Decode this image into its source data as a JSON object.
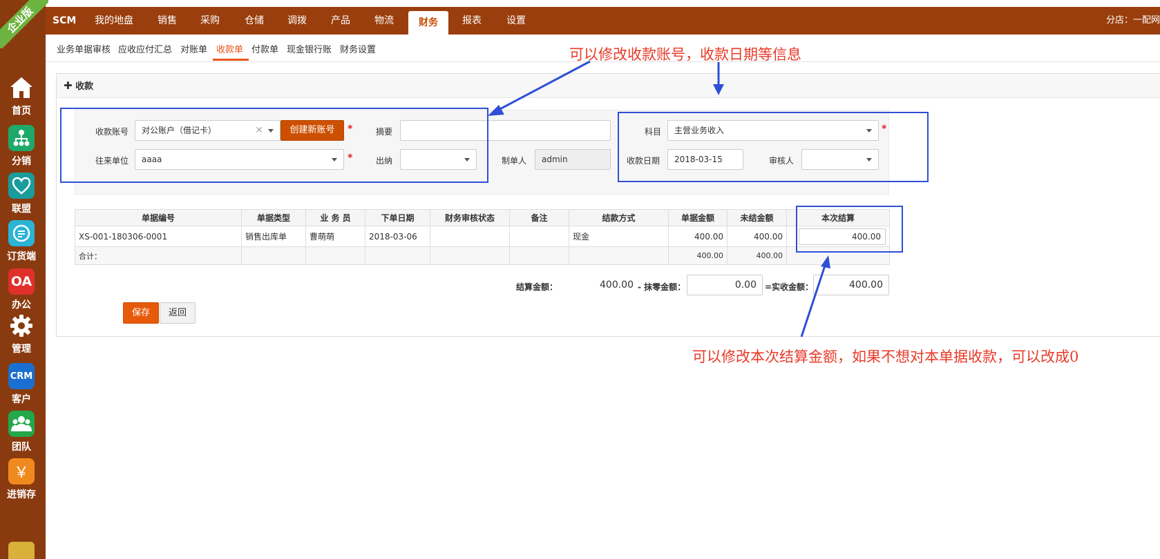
{
  "sidebar": {
    "ribbon": "企业版",
    "items": [
      {
        "label": "首页",
        "icon": "home-icon"
      },
      {
        "label": "分销",
        "icon": "distribution-icon"
      },
      {
        "label": "联盟",
        "icon": "alliance-icon"
      },
      {
        "label": "订货端",
        "icon": "order-client-icon"
      },
      {
        "label": "办公",
        "icon": "oa-icon",
        "text": "OA"
      },
      {
        "label": "管理",
        "icon": "gear-icon"
      },
      {
        "label": "客户",
        "icon": "crm-icon",
        "text": "CRM"
      },
      {
        "label": "团队",
        "icon": "team-icon"
      },
      {
        "label": "进销存",
        "icon": "yen-icon",
        "text": "￥"
      }
    ]
  },
  "topnav": {
    "brand": "SCM",
    "items": [
      "我的地盘",
      "销售",
      "采购",
      "仓储",
      "调拨",
      "产品",
      "物流",
      "财务",
      "报表",
      "设置"
    ],
    "active": "财务",
    "branch": "分店：一配网"
  },
  "subtabs": {
    "items": [
      "业务单据审核",
      "应收应付汇总",
      "对账单",
      "收款单",
      "付款单",
      "现金银行账",
      "财务设置"
    ],
    "active": "收款单"
  },
  "panel": {
    "title": "收款"
  },
  "form": {
    "account_label": "收款账号",
    "account_value": "对公账户（借记卡）",
    "create_account_label": "创建新账号",
    "summary_label": "摘要",
    "summary_value": "",
    "subject_label": "科目",
    "subject_value": "主营业务收入",
    "partner_label": "往来单位",
    "partner_value": "aaaa",
    "cashier_label": "出纳",
    "cashier_value": "",
    "maker_label": "制单人",
    "maker_value": "admin",
    "date_label": "收款日期",
    "date_value": "2018-03-15",
    "reviewer_label": "审核人",
    "reviewer_value": "",
    "required_mark": "*"
  },
  "table": {
    "headers": [
      "单据编号",
      "单据类型",
      "业 务 员",
      "下单日期",
      "财务审核状态",
      "备注",
      "结款方式",
      "单据金额",
      "未结金额",
      "本次结算"
    ],
    "rows": [
      [
        "XS-001-180306-0001",
        "销售出库单",
        "曹萌萌",
        "2018-03-06",
        "",
        "",
        "现金",
        "400.00",
        "400.00",
        "400.00"
      ]
    ],
    "summary": {
      "label": "合计：",
      "doc_amount": "400.00",
      "unsettled": "400.00"
    }
  },
  "totals": {
    "settle_label": "结算金额：",
    "settle_value": "400.00",
    "discount_label": "- 抹零金额：",
    "discount_value": "0.00",
    "actual_label": "=实收金额：",
    "actual_value": "400.00"
  },
  "buttons": {
    "save": "保存",
    "back": "返回"
  },
  "annotations": {
    "top": "可以修改收款账号，收款日期等信息",
    "bottom": "可以修改本次结算金额，如果不想对本单据收款，可以改成0",
    "box_color": "#2f4fd6",
    "text_color": "#e83a28"
  },
  "colors": {
    "sidebar": "#8a3a0f",
    "topbar": "#9a3e0d",
    "accent": "#e8561a"
  }
}
